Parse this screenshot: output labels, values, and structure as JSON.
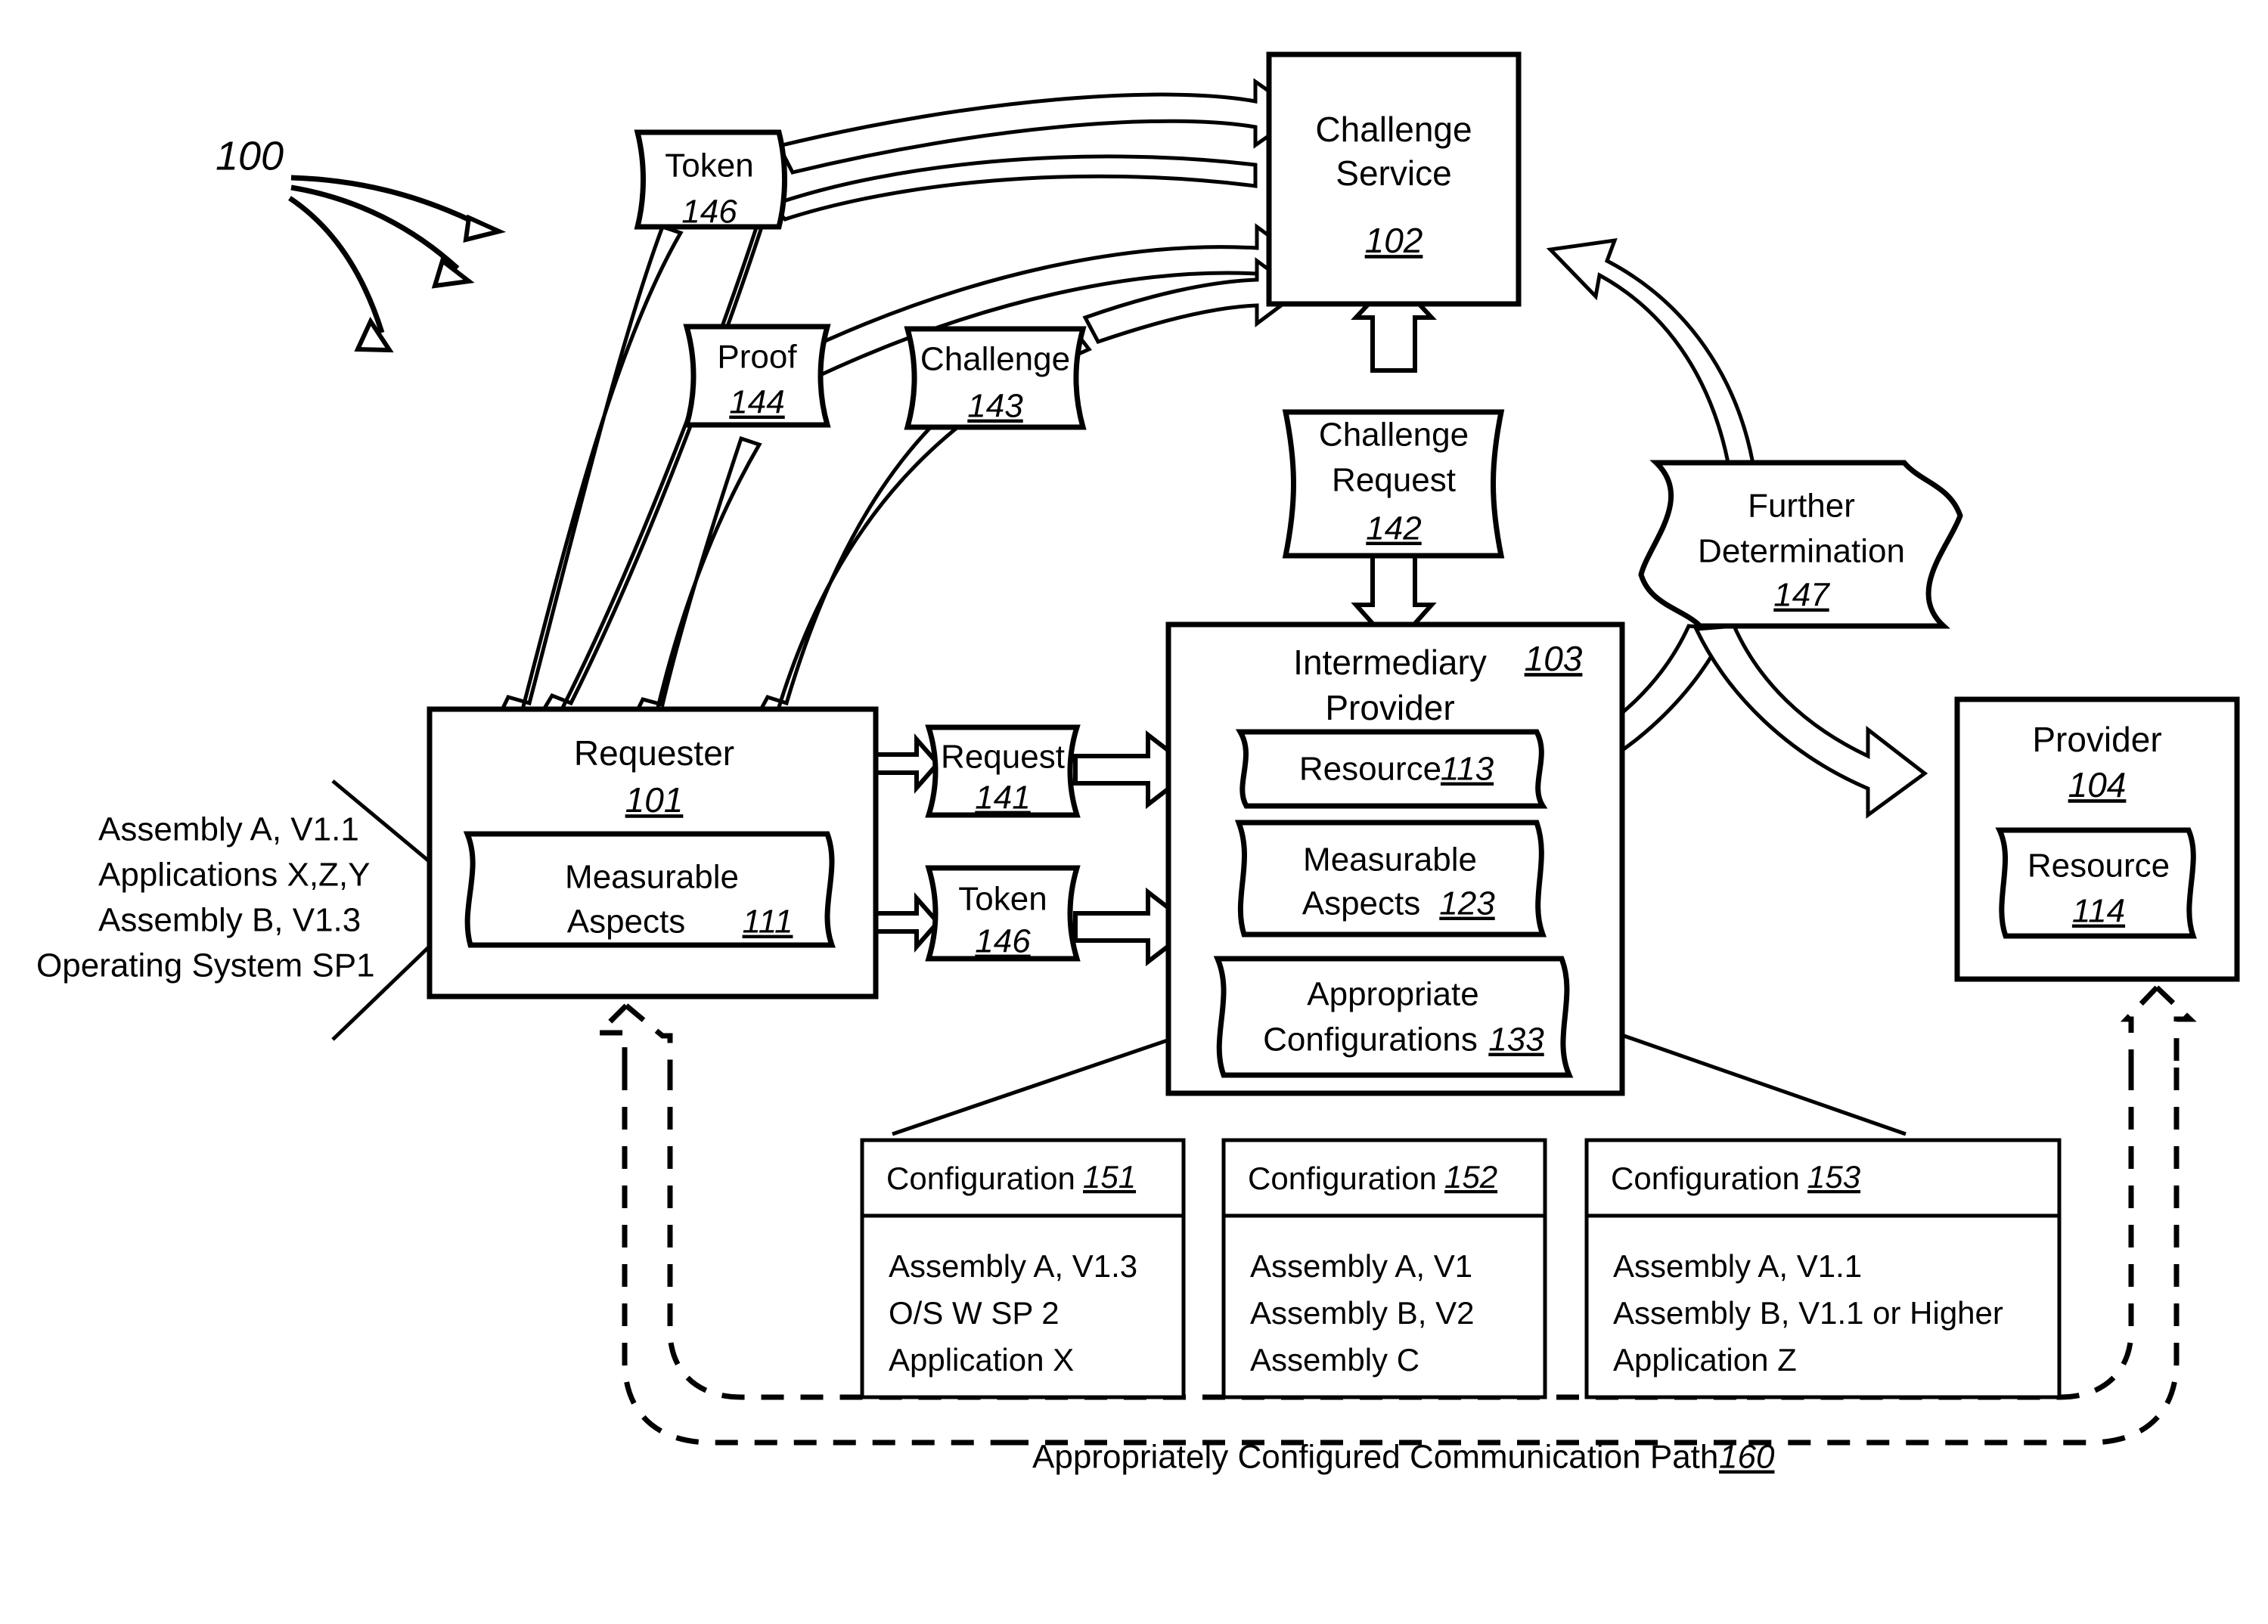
{
  "figure": {
    "ref_label": "100"
  },
  "nodes": {
    "challenge_service": {
      "title_line1": "Challenge",
      "title_line2": "Service",
      "num": "102"
    },
    "requester": {
      "title": "Requester",
      "num": "101"
    },
    "measurable_aspects_111": {
      "line1": "Measurable",
      "line2": "Aspects",
      "num": "111"
    },
    "intermediary_provider": {
      "title_line1": "Intermediary",
      "title_line2": "Provider",
      "num": "103"
    },
    "resource_113": {
      "label": "Resource",
      "num": "113"
    },
    "measurable_aspects_123": {
      "line1": "Measurable",
      "line2": "Aspects",
      "num": "123"
    },
    "appropriate_configurations_133": {
      "line1": "Appropriate",
      "line2": "Configurations",
      "num": "133"
    },
    "provider": {
      "title": "Provider",
      "num": "104"
    },
    "resource_114": {
      "label": "Resource",
      "num": "114"
    }
  },
  "messages": {
    "token_top": {
      "label": "Token",
      "num": "146"
    },
    "proof": {
      "label": "Proof",
      "num": "144"
    },
    "challenge": {
      "label": "Challenge",
      "num": "143"
    },
    "challenge_request": {
      "line1": "Challenge",
      "line2": "Request",
      "num": "142"
    },
    "further_determination": {
      "line1": "Further",
      "line2": "Determination",
      "num": "147"
    },
    "request": {
      "label": "Request",
      "num": "141"
    },
    "token_mid": {
      "label": "Token",
      "num": "146"
    }
  },
  "requester_aspects_list": [
    "Assembly A, V1.1",
    "Applications X,Z,Y",
    "Assembly B, V1.3",
    "Operating System SP1"
  ],
  "configurations": [
    {
      "header": "Configuration",
      "num": "151",
      "lines": [
        "Assembly  A,  V1.3",
        "O/S  W  SP  2",
        "Application  X"
      ]
    },
    {
      "header": "Configuration",
      "num": "152",
      "lines": [
        "Assembly  A,  V1",
        "Assembly  B,  V2",
        "Assembly  C"
      ]
    },
    {
      "header": "Configuration",
      "num": "153",
      "lines": [
        "Assembly  A,  V1.1",
        "Assembly  B,  V1.1 or Higher",
        "Application  Z"
      ]
    }
  ],
  "comm_path": {
    "label": "Appropriately Configured Communication Path",
    "num": "160"
  }
}
